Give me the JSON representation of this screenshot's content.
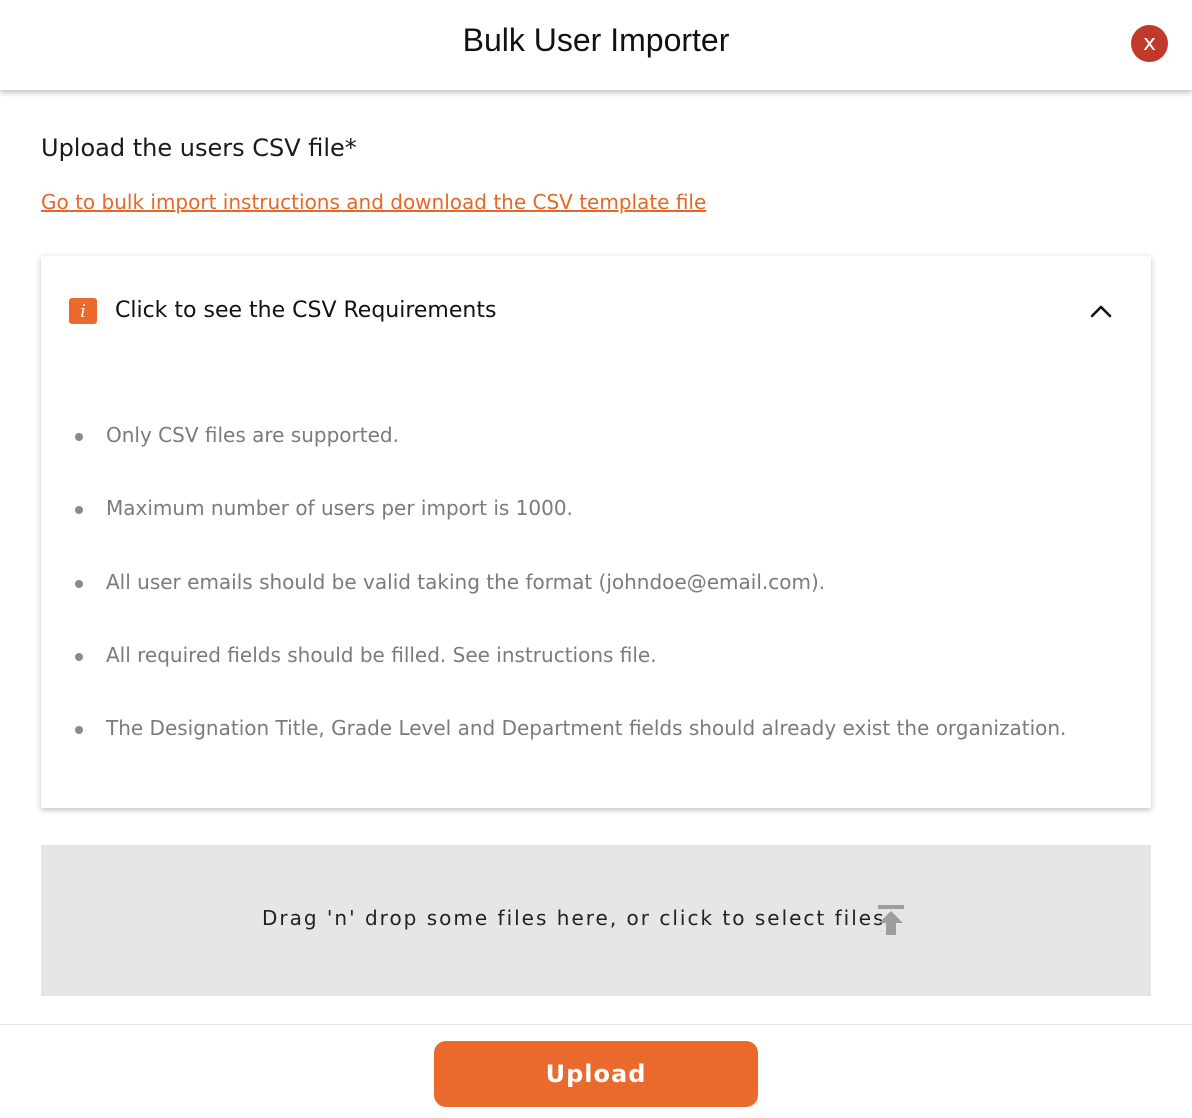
{
  "header": {
    "title": "Bulk User Importer",
    "close_label": "x"
  },
  "upload_section": {
    "label": "Upload the users CSV file*",
    "instructions_link": "Go to bulk import instructions and download the CSV template file"
  },
  "requirements": {
    "title": "Click to see the CSV Requirements",
    "info_icon_label": "i",
    "expanded": true,
    "items": [
      "Only CSV files are supported.",
      "Maximum number of users per import is 1000.",
      "All user emails should be valid taking the format (johndoe@email.com).",
      "All required fields should be filled. See instructions file.",
      "The Designation Title, Grade Level and Department fields should already exist the organization."
    ]
  },
  "dropzone": {
    "text": "Drag 'n' drop some files here, or click to select files"
  },
  "footer": {
    "upload_label": "Upload"
  },
  "colors": {
    "accent": "#ea6a2d",
    "close": "#c0392b",
    "dropzone_bg": "#e6e6e6"
  },
  "icons": [
    "close-icon",
    "info-icon",
    "chevron-up-icon",
    "upload-icon"
  ]
}
